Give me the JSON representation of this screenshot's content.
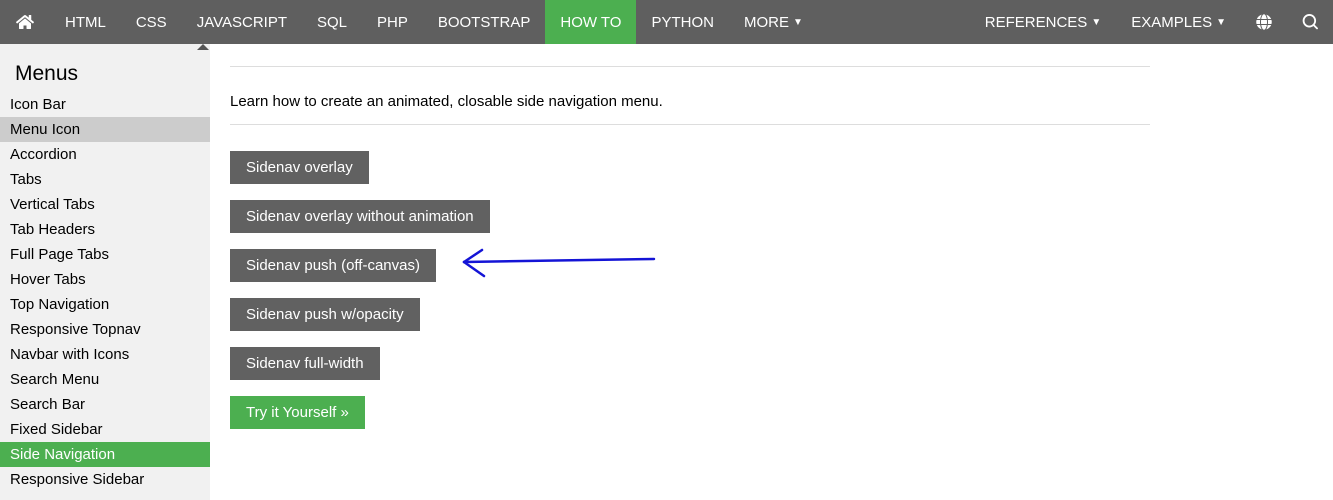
{
  "topnav": {
    "items_left": [
      {
        "label": "HTML",
        "active": false
      },
      {
        "label": "CSS",
        "active": false
      },
      {
        "label": "JAVASCRIPT",
        "active": false
      },
      {
        "label": "SQL",
        "active": false
      },
      {
        "label": "PHP",
        "active": false
      },
      {
        "label": "BOOTSTRAP",
        "active": false
      },
      {
        "label": "HOW TO",
        "active": true
      },
      {
        "label": "PYTHON",
        "active": false
      },
      {
        "label": "MORE",
        "active": false,
        "caret": true
      }
    ],
    "items_right": [
      {
        "label": "REFERENCES",
        "caret": true
      },
      {
        "label": "EXAMPLES",
        "caret": true
      }
    ]
  },
  "sidebar": {
    "heading": "Menus",
    "items": [
      {
        "label": "Icon Bar"
      },
      {
        "label": "Menu Icon",
        "selected": true
      },
      {
        "label": "Accordion"
      },
      {
        "label": "Tabs"
      },
      {
        "label": "Vertical Tabs"
      },
      {
        "label": "Tab Headers"
      },
      {
        "label": "Full Page Tabs"
      },
      {
        "label": "Hover Tabs"
      },
      {
        "label": "Top Navigation"
      },
      {
        "label": "Responsive Topnav"
      },
      {
        "label": "Navbar with Icons"
      },
      {
        "label": "Search Menu"
      },
      {
        "label": "Search Bar"
      },
      {
        "label": "Fixed Sidebar"
      },
      {
        "label": "Side Navigation",
        "active": true
      },
      {
        "label": "Responsive Sidebar"
      }
    ]
  },
  "main": {
    "intro": "Learn how to create an animated, closable side navigation menu.",
    "buttons": [
      "Sidenav overlay",
      "Sidenav overlay without animation",
      "Sidenav push (off-canvas)",
      "Sidenav push w/opacity",
      "Sidenav full-width"
    ],
    "try_it": "Try it Yourself »"
  },
  "colors": {
    "accent": "#4CAF50",
    "topnav_bg": "#5f5f5f",
    "btn_bg": "#616161"
  }
}
